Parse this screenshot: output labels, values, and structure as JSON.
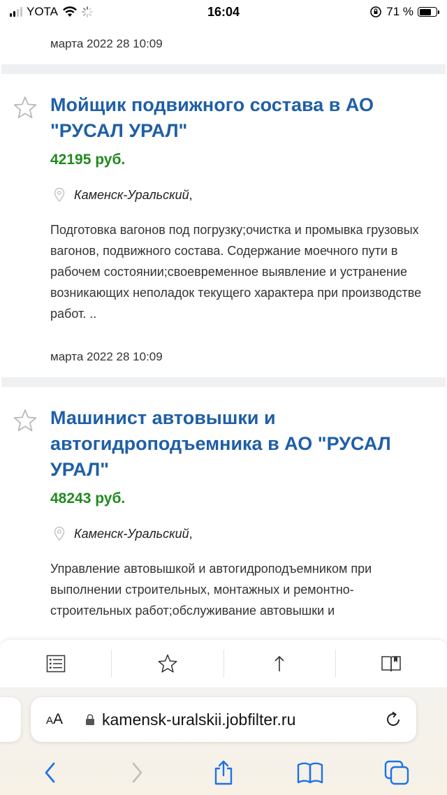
{
  "status": {
    "carrier": "YOTA",
    "time": "16:04",
    "battery": "71 %",
    "battery_level": 0.71
  },
  "list": {
    "first_date": "марта 2022 28 10:09",
    "jobs": [
      {
        "title": "Мойщик подвижного состава в АО \"РУСАЛ УРАЛ\"",
        "salary": "42195 руб.",
        "location": "Каменск-Уральский",
        "location_suffix": ",",
        "description": "Подготовка вагонов под погрузку;очистка и промывка грузовых вагонов, подвижного состава. Содержание моечного пути в рабочем состоянии;своевременное выявление и устранение возникающих неполадок текущего характера при производстве работ. ..",
        "date": "марта 2022 28 10:09"
      },
      {
        "title": "Машинист автовышки и автогидроподъемника в АО \"РУСАЛ УРАЛ\"",
        "salary": "48243 руб.",
        "location": "Каменск-Уральский",
        "location_suffix": ",",
        "description": "Управление автовышкой и автогидроподъемником при выполнении строительных, монтажных и ремонтно-строительных работ;обслуживание автовышки и"
      }
    ]
  },
  "site_toolbar": {
    "icons": [
      "list-icon",
      "star-icon",
      "arrow-up-icon",
      "reader-icon"
    ]
  },
  "safari": {
    "aa_label_small": "A",
    "aa_label_big": "A",
    "url": "kamensk-uralskii.jobfilter.ru",
    "nav_icons": [
      "back-icon",
      "forward-icon",
      "share-icon",
      "bookmarks-icon",
      "tabs-icon"
    ]
  },
  "colors": {
    "title": "#1f5fa6",
    "salary": "#1f8a1f",
    "safari_accent": "#1a73e8"
  }
}
